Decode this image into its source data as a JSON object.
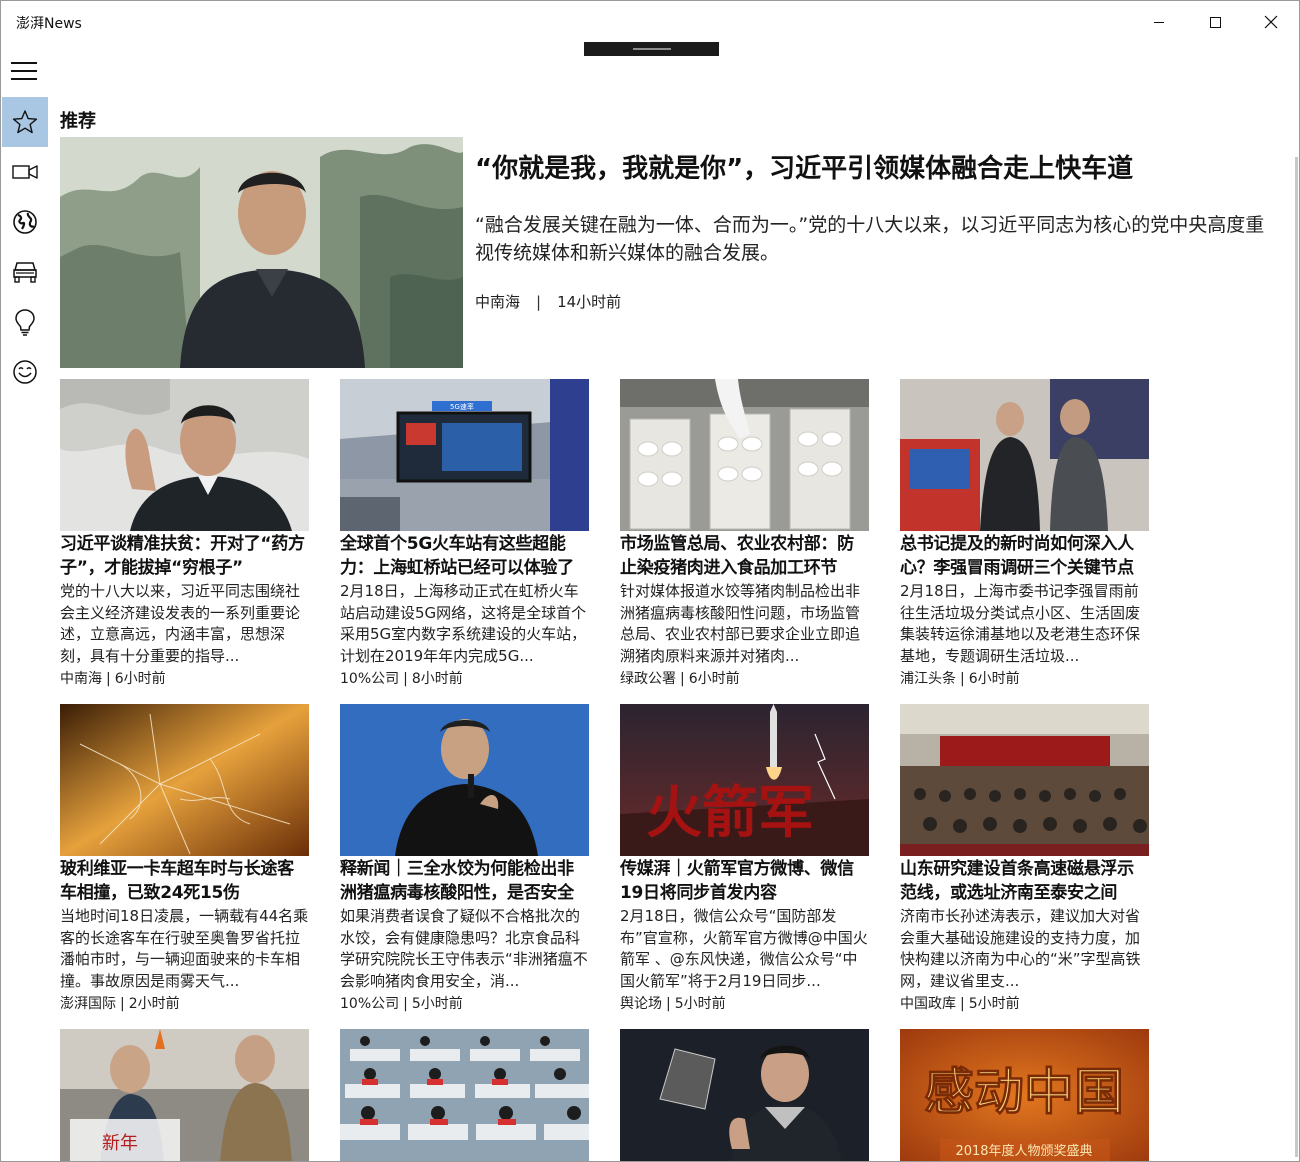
{
  "app": {
    "title": "澎湃News"
  },
  "section": {
    "title": "推荐"
  },
  "nav": {
    "items": [
      {
        "icon": "star-icon",
        "active": true
      },
      {
        "icon": "video-icon",
        "active": false
      },
      {
        "icon": "globe-icon",
        "active": false
      },
      {
        "icon": "car-icon",
        "active": false
      },
      {
        "icon": "lightbulb-icon",
        "active": false
      },
      {
        "icon": "smiley-icon",
        "active": false
      }
    ]
  },
  "hero": {
    "title": "“你就是我，我就是你”，习近平引领媒体融合走上快车道",
    "summary": "“融合发展关键在融为一体、合而为一。”党的十八大以来，以习近平同志为核心的党中央高度重视传统媒体和新兴媒体的融合发展。",
    "source": "中南海",
    "separator": "|",
    "time": "14小时前"
  },
  "cards": [
    {
      "title": "习近平谈精准扶贫：开对了“药方子”，才能拔掉“穷根子”",
      "summary": "党的十八大以来，习近平同志围绕社会主义经济建设发表的一系列重要论述，立意高远，内涵丰富，思想深刻，具有十分重要的指导...",
      "source": "中南海",
      "sep": "|",
      "time": "6小时前"
    },
    {
      "title": "全球首个5G火车站有这些超能力：上海虹桥站已经可以体验了",
      "summary": "2月18日，上海移动正式在虹桥火车站启动建设5G网络，这将是全球首个采用5G室内数字系统建设的火车站，计划在2019年年内完成5G...",
      "source": "10%公司",
      "sep": "|",
      "time": "8小时前"
    },
    {
      "title": "市场监管总局、农业农村部：防止染疫猪肉进入食品加工环节",
      "summary": "针对媒体报道水饺等猪肉制品检出非洲猪瘟病毒核酸阳性问题，市场监管总局、农业农村部已要求企业立即追溯猪肉原料来源并对猪肉...",
      "source": "绿政公署",
      "sep": "|",
      "time": "6小时前"
    },
    {
      "title": "总书记提及的新时尚如何深入人心？李强冒雨调研三个关键节点",
      "summary": "2月18日，上海市委书记李强冒雨前往生活垃圾分类试点小区、生活固废集装转运徐浦基地以及老港生态环保基地，专题调研生活垃圾...",
      "source": "浦江头条",
      "sep": "|",
      "time": "6小时前"
    },
    {
      "title": "玻利维亚一卡车超车时与长途客车相撞，已致24死15伤",
      "summary": "当地时间18日凌晨，一辆载有44名乘客的长途客车在行驶至奥鲁罗省托拉潘帕市时，与一辆迎面驶来的卡车相撞。事故原因是雨雾天气...",
      "source": "澎湃国际",
      "sep": "|",
      "time": "2小时前"
    },
    {
      "title": "释新闻｜三全水饺为何能检出非洲猪瘟病毒核酸阳性，是否安全",
      "summary": "如果消费者误食了疑似不合格批次的水饺，会有健康隐患吗？北京食品科学研究院院长王守伟表示“非洲猪瘟不会影响猪肉食用安全，消...",
      "source": "10%公司",
      "sep": "|",
      "time": "5小时前"
    },
    {
      "title": "传媒湃｜火箭军官方微博、微信19日将同步首发内容",
      "summary": "2月18日，微信公众号“国防部发布”官宣称，火箭军官方微博@中国火箭军 、@东风快递，微信公众号“中国火箭军”将于2月19日同步...",
      "source": "舆论场",
      "sep": "|",
      "time": "5小时前"
    },
    {
      "title": "山东研究建设首条高速磁悬浮示范线，或选址济南至泰安之间",
      "summary": "济南市长孙述涛表示，建议加大对省会重大基础设施建设的支持力度，加快构建以济南为中心的“米”字型高铁网，建议省里支...",
      "source": "中国政库",
      "sep": "|",
      "time": "5小时前"
    }
  ],
  "image_text": {
    "rocket": "火箭军",
    "moved": "感动中国",
    "moved_sub": "2018年度人物颁奖盛典",
    "banner5g": "5G速率",
    "newyear": "新年"
  },
  "colors": {
    "nav_active": "#a9c6e3",
    "titlebar": "#ffffff",
    "drag_handle": "#1b1b1b"
  }
}
